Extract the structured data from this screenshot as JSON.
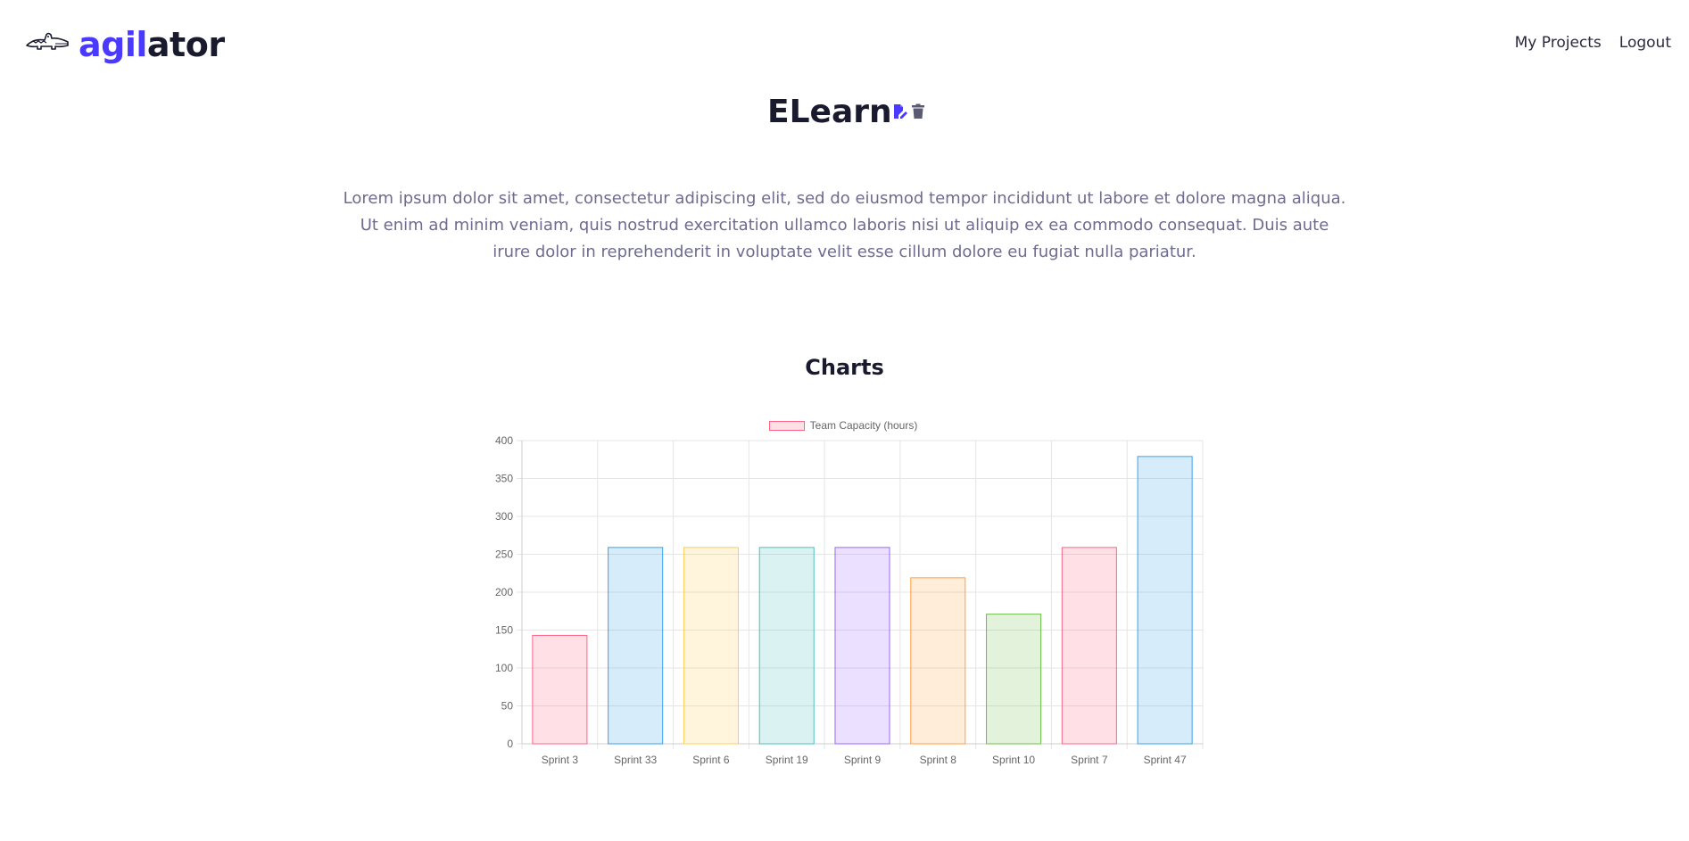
{
  "app": {
    "logo_part1": "agil",
    "logo_part2": "ator",
    "logo_icon": "crocodile-icon"
  },
  "nav": {
    "items": [
      {
        "label": "My Projects"
      },
      {
        "label": "Logout"
      }
    ]
  },
  "project": {
    "title": "ELearn",
    "edit_icon": "edit-icon",
    "delete_icon": "trash-icon",
    "description": "Lorem ipsum dolor sit amet, consectetur adipiscing elit, sed do eiusmod tempor incididunt ut labore et dolore magna aliqua. Ut enim ad minim veniam, quis nostrud exercitation ullamco laboris nisi ut aliquip ex ea commodo consequat. Duis aute irure dolor in reprehenderit in voluptate velit esse cillum dolore eu fugiat nulla pariatur."
  },
  "charts_section": {
    "title": "Charts"
  },
  "colors": {
    "brand": "#4a3aff",
    "text_dark": "#1a1a2e",
    "text_muted": "#6e6b8f"
  },
  "chart_data": {
    "type": "bar",
    "title": "",
    "xlabel": "",
    "ylabel": "",
    "ylim": [
      0,
      400
    ],
    "yticks": [
      0,
      50,
      100,
      150,
      200,
      250,
      300,
      350,
      400
    ],
    "grid": true,
    "legend_position": "top-center",
    "categories": [
      "Sprint 3",
      "Sprint 33",
      "Sprint 6",
      "Sprint 19",
      "Sprint 9",
      "Sprint 8",
      "Sprint 10",
      "Sprint 7",
      "Sprint 47"
    ],
    "series": [
      {
        "name": "Team Capacity (hours)",
        "values": [
          143,
          259,
          259,
          259,
          259,
          219,
          171,
          259,
          379
        ]
      }
    ],
    "bar_colors": [
      {
        "border": "#ff6384",
        "fill": "rgba(255,99,132,0.2)"
      },
      {
        "border": "#36a2eb",
        "fill": "rgba(54,162,235,0.2)"
      },
      {
        "border": "#ffcd56",
        "fill": "rgba(255,205,86,0.2)"
      },
      {
        "border": "#4bc0c0",
        "fill": "rgba(75,192,192,0.2)"
      },
      {
        "border": "#9966ff",
        "fill": "rgba(153,102,255,0.2)"
      },
      {
        "border": "#ff9f40",
        "fill": "rgba(255,159,64,0.2)"
      },
      {
        "border": "#6cc04a",
        "fill": "rgba(108,192,74,0.2)"
      },
      {
        "border": "#ff6384",
        "fill": "rgba(255,99,132,0.2)"
      },
      {
        "border": "#36a2eb",
        "fill": "rgba(54,162,235,0.2)"
      }
    ]
  }
}
